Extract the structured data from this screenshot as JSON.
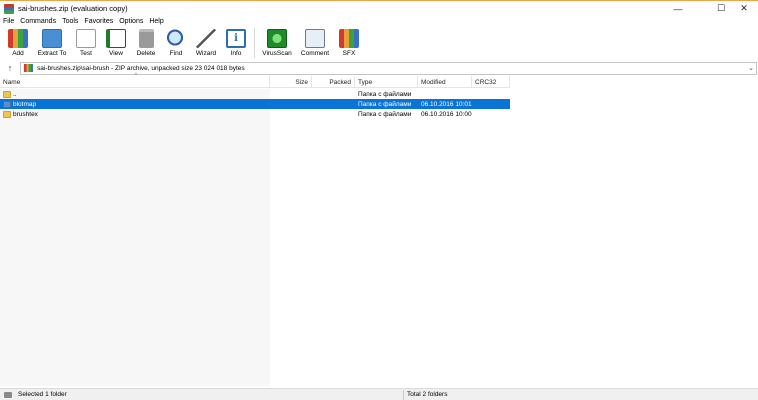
{
  "window": {
    "title": "sai-brushes.zip (evaluation copy)",
    "minimize_glyph": "—",
    "maximize_glyph": "☐",
    "close_glyph": "✕"
  },
  "menu": [
    "File",
    "Commands",
    "Tools",
    "Favorites",
    "Options",
    "Help"
  ],
  "toolbar": [
    {
      "id": "add",
      "label": "Add",
      "icon": "add-archive-icon"
    },
    {
      "id": "extract",
      "label": "Extract To",
      "icon": "extract-folder-icon"
    },
    {
      "id": "test",
      "label": "Test",
      "icon": "test-icon"
    },
    {
      "id": "view",
      "label": "View",
      "icon": "view-book-icon"
    },
    {
      "id": "delete",
      "label": "Delete",
      "icon": "trash-icon"
    },
    {
      "id": "find",
      "label": "Find",
      "icon": "magnifier-icon"
    },
    {
      "id": "wizard",
      "label": "Wizard",
      "icon": "wand-icon"
    },
    {
      "id": "info",
      "label": "Info",
      "icon": "info-icon"
    },
    {
      "id": "virusscan",
      "label": "VirusScan",
      "icon": "virus-scan-icon"
    },
    {
      "id": "comment",
      "label": "Comment",
      "icon": "comment-icon"
    },
    {
      "id": "sfx",
      "label": "SFX",
      "icon": "sfx-icon"
    }
  ],
  "address": {
    "up_glyph": "↑",
    "path": "sai-brushes.zip\\sai-brush - ZIP archive, unpacked size 23 024 018 bytes",
    "dropdown_glyph": "⌄"
  },
  "columns": {
    "name": "Name",
    "size": "Size",
    "packed": "Packed",
    "type": "Type",
    "modified": "Modified",
    "crc": "CRC32",
    "sort_caret": "^"
  },
  "rows": [
    {
      "name": "..",
      "size": "",
      "packed": "",
      "type": "Папка с файлами",
      "modified": "",
      "crc": "",
      "selected": false
    },
    {
      "name": "blotmap",
      "size": "",
      "packed": "",
      "type": "Папка с файлами",
      "modified": "06.10.2016 10:01",
      "crc": "",
      "selected": true
    },
    {
      "name": "brushtex",
      "size": "",
      "packed": "",
      "type": "Папка с файлами",
      "modified": "06.10.2016 10:00",
      "crc": "",
      "selected": false
    }
  ],
  "status": {
    "left": "Selected 1 folder",
    "right": "Total 2 folders"
  },
  "colors": {
    "selection": "#0a74d6",
    "title_accent": "#e6a84a"
  }
}
